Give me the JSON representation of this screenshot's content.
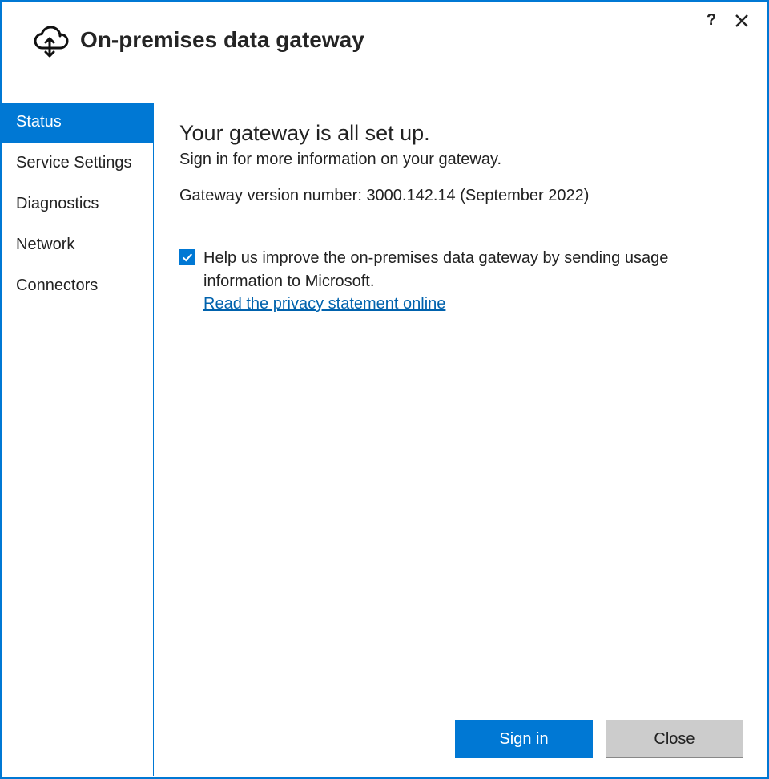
{
  "header": {
    "title": "On-premises data gateway"
  },
  "sidebar": {
    "items": [
      {
        "label": "Status",
        "selected": true
      },
      {
        "label": "Service Settings",
        "selected": false
      },
      {
        "label": "Diagnostics",
        "selected": false
      },
      {
        "label": "Network",
        "selected": false
      },
      {
        "label": "Connectors",
        "selected": false
      }
    ]
  },
  "main": {
    "heading": "Your gateway is all set up.",
    "subheading": "Sign in for more information on your gateway.",
    "version_line": "Gateway version number: 3000.142.14 (September 2022)",
    "telemetry_checked": true,
    "telemetry_text": "Help us improve the on-premises data gateway by sending usage information to Microsoft.",
    "privacy_link": "Read the privacy statement online"
  },
  "footer": {
    "primary": "Sign in",
    "secondary": "Close"
  }
}
